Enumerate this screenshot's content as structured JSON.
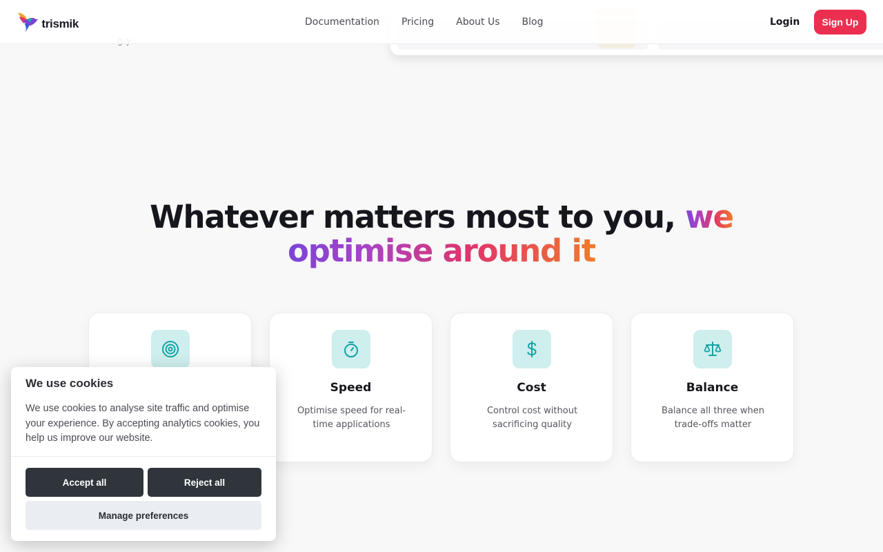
{
  "brand": {
    "name": "trismik"
  },
  "nav": {
    "items": [
      "Documentation",
      "Pricing",
      "About Us",
      "Blog"
    ],
    "login_label": "Login",
    "signup_label": "Sign Up"
  },
  "colors": {
    "accent_red": "#ec2f50",
    "icon_teal": "#14a3a3",
    "icon_bg": "#cfeeee",
    "gradient": [
      "#7a44d8",
      "#e0356a",
      "#f07a2a"
    ]
  },
  "headline": {
    "plain": "Whatever matters most to you,",
    "highlight_1": "we",
    "highlight_2": "optimise around it"
  },
  "features": [
    {
      "icon": "target-icon",
      "title": "",
      "desc": ""
    },
    {
      "icon": "stopwatch-icon",
      "title": "Speed",
      "desc": "Optimise speed for real-time applications"
    },
    {
      "icon": "dollar-icon",
      "title": "Cost",
      "desc": "Control cost without sacrificing quality"
    },
    {
      "icon": "scale-icon",
      "title": "Balance",
      "desc": "Balance all three when trade-offs matter"
    }
  ],
  "cookie": {
    "title": "We use cookies",
    "body": "We use cookies to analyse site traffic and optimise your experience. By accepting analytics cookies, you help us improve our website.",
    "accept_label": "Accept all",
    "reject_label": "Reject all",
    "manage_label": "Manage preferences"
  }
}
